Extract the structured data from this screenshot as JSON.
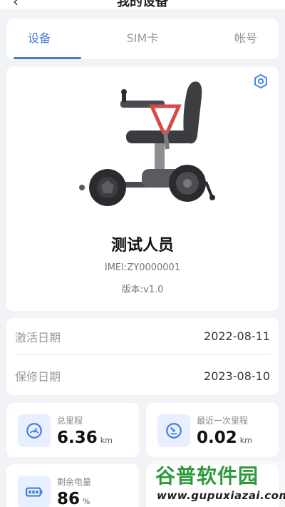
{
  "topnav": {
    "back": "‹",
    "title": "我的设备"
  },
  "tabs": [
    {
      "label": "设备",
      "active": true
    },
    {
      "label": "SIM卡",
      "active": false
    },
    {
      "label": "帐号",
      "active": false
    }
  ],
  "device": {
    "name": "测试人员",
    "imei": "IMEI:ZY0000001",
    "version": "版本:v1.0"
  },
  "dates": {
    "activation_label": "激活日期",
    "activation_value": "2022-08-11",
    "warranty_label": "保修日期",
    "warranty_value": "2023-08-10"
  },
  "stats": [
    {
      "label": "总里程",
      "value": "6.36",
      "unit": "km",
      "icon": "speedometer-icon"
    },
    {
      "label": "最近一次里程",
      "value": "0.02",
      "unit": "km",
      "icon": "gauge-icon"
    },
    {
      "label": "剩余电量",
      "value": "86",
      "unit": "%",
      "icon": "battery-icon"
    },
    {
      "label": "",
      "value": "",
      "unit": "",
      "icon": ""
    }
  ],
  "watermark": {
    "title": "谷普软件园",
    "url": "www.gupuxiazai.com"
  },
  "colors": {
    "accent": "#3e7ce0",
    "background": "#f2f3f7",
    "watermark_green": "#2e9a3c"
  }
}
